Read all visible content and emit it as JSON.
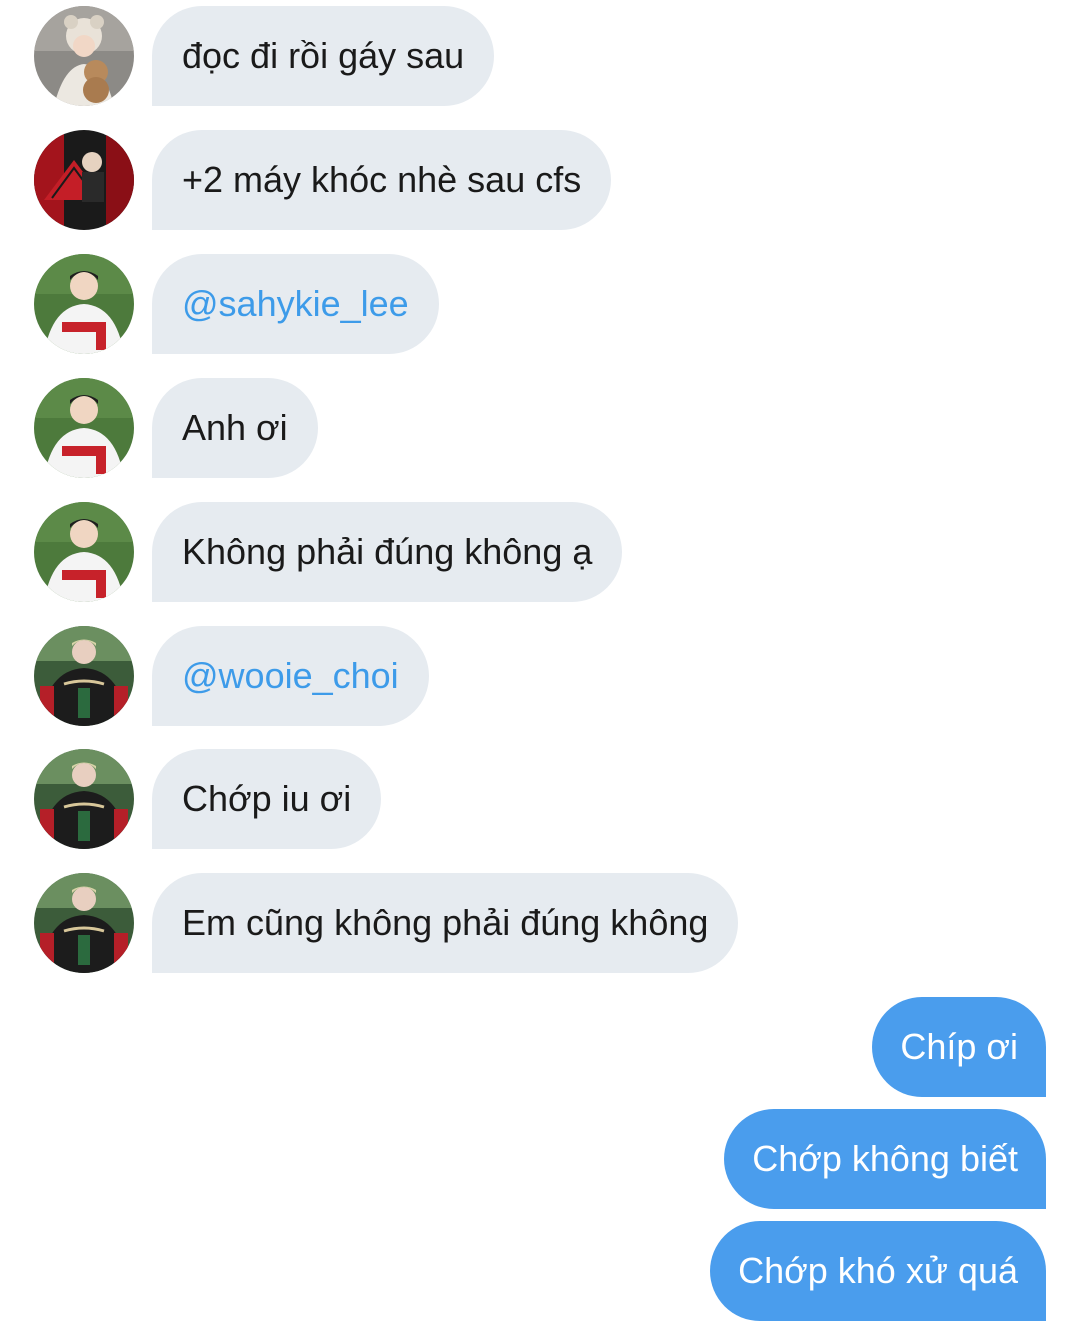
{
  "colors": {
    "incoming_bubble": "#e6ebf0",
    "outgoing_bubble": "#4a9ded",
    "mention_text": "#3d9be9"
  },
  "messages": [
    {
      "direction": "incoming",
      "text": "đọc đi rồi gáy sau",
      "avatar": "avatar-girl-with-teddy-bear"
    },
    {
      "direction": "incoming",
      "text": "+2 máy khóc nhè sau cfs",
      "avatar": "avatar-red-fan-background"
    },
    {
      "direction": "incoming",
      "text": "@sahykie_lee",
      "avatar": "avatar-baseball-jersey-landers",
      "mention": true
    },
    {
      "direction": "incoming",
      "text": "Anh ơi",
      "avatar": "avatar-baseball-jersey-landers"
    },
    {
      "direction": "incoming",
      "text": "Không phải đúng không ạ",
      "avatar": "avatar-baseball-jersey-landers"
    },
    {
      "direction": "incoming",
      "text": "@wooie_choi",
      "avatar": "avatar-black-varsity-jacket",
      "mention": true
    },
    {
      "direction": "incoming",
      "text": "Chớp iu ơi",
      "avatar": "avatar-black-varsity-jacket"
    },
    {
      "direction": "incoming",
      "text": "Em cũng không phải đúng không",
      "avatar": "avatar-black-varsity-jacket"
    },
    {
      "direction": "outgoing",
      "text": "Chíp ơi"
    },
    {
      "direction": "outgoing",
      "text": "Chớp không biết"
    },
    {
      "direction": "outgoing",
      "text": "Chớp khó xử quá"
    }
  ]
}
